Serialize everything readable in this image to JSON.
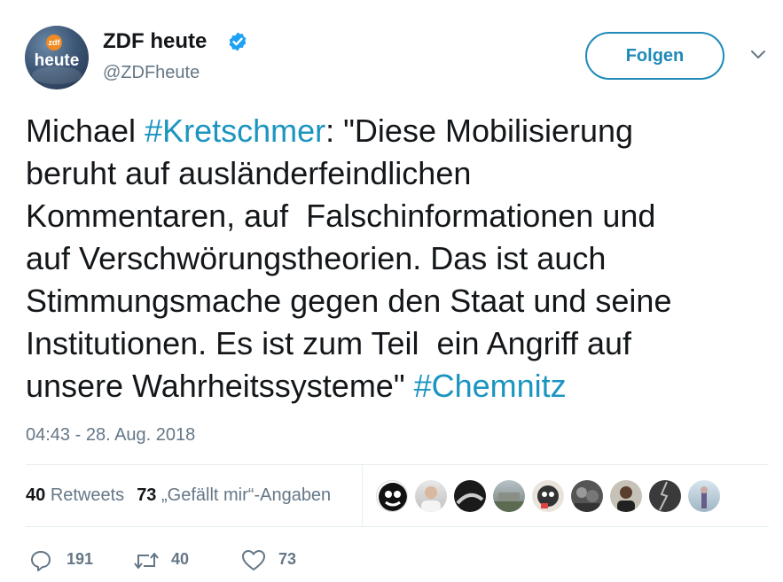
{
  "account": {
    "name": "ZDF heute",
    "handle": "@ZDFheute",
    "avatar_logo": "heute",
    "avatar_badge": "zdf",
    "verified": true
  },
  "header": {
    "follow_label": "Folgen",
    "menu_icon": "chevron-down-icon"
  },
  "tweet": {
    "text_parts": {
      "p1": "Michael ",
      "h1": "#Kretschmer",
      "p2": ": \"Diese Mobilisierung\nberuht auf ausländerfeindlichen\nKommentaren, auf  Falschinformationen und\nauf Verschwörungstheorien. Das ist auch\nStimmungsmache gegen den Staat und seine\nInstitutionen. Es ist zum Teil  ein Angriff auf\nunsere Wahrheitssysteme\" ",
      "h2": "#Chemnitz"
    },
    "timestamp": "04:43 - 28. Aug. 2018"
  },
  "stats": {
    "retweets_count": "40",
    "retweets_label": "Retweets",
    "likes_count": "73",
    "likes_label": "„Gefällt mir“-Angaben"
  },
  "actions": {
    "reply_count": "191",
    "retweet_count": "40",
    "like_count": "73"
  },
  "colors": {
    "hashtag": "#1b95c0",
    "follow_border": "#1d8ab8",
    "muted": "#657786",
    "verified": "#1da1f2"
  }
}
